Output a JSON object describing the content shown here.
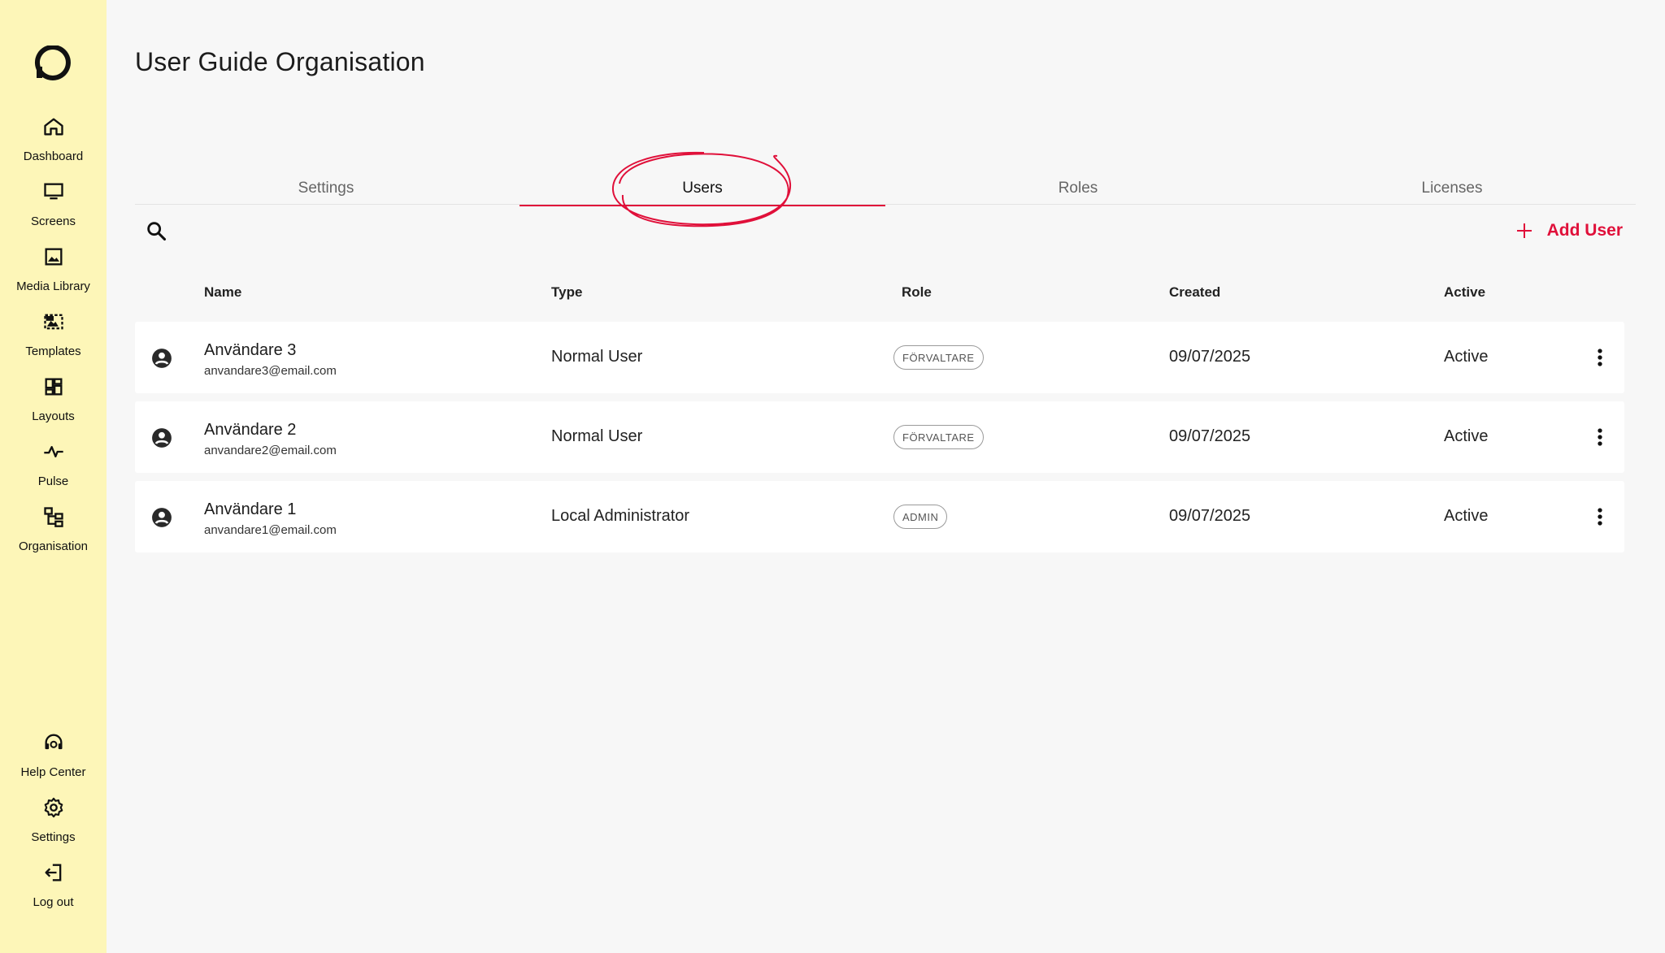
{
  "sidebar": {
    "logo": "logo-icon",
    "items": [
      {
        "label": "Dashboard",
        "icon": "home-icon"
      },
      {
        "label": "Screens",
        "icon": "monitor-icon"
      },
      {
        "label": "Media Library",
        "icon": "image-icon"
      },
      {
        "label": "Templates",
        "icon": "template-icon"
      },
      {
        "label": "Layouts",
        "icon": "layout-icon"
      },
      {
        "label": "Pulse",
        "icon": "pulse-icon"
      },
      {
        "label": "Organisation",
        "icon": "org-icon"
      }
    ],
    "bottom_items": [
      {
        "label": "Help Center",
        "icon": "headset-icon"
      },
      {
        "label": "Settings",
        "icon": "gear-icon"
      },
      {
        "label": "Log out",
        "icon": "logout-icon"
      }
    ]
  },
  "page": {
    "title": "User Guide Organisation"
  },
  "tabs": [
    {
      "label": "Settings",
      "active": false
    },
    {
      "label": "Users",
      "active": true
    },
    {
      "label": "Roles",
      "active": false
    },
    {
      "label": "Licenses",
      "active": false
    }
  ],
  "toolbar": {
    "add_user_label": "Add User"
  },
  "table": {
    "headers": {
      "name": "Name",
      "type": "Type",
      "role": "Role",
      "created": "Created",
      "active": "Active"
    },
    "rows": [
      {
        "name": "Användare 3",
        "email": "anvandare3@email.com",
        "type": "Normal User",
        "role": "FÖRVALTARE",
        "created": "09/07/2025",
        "active": "Active"
      },
      {
        "name": "Användare 2",
        "email": "anvandare2@email.com",
        "type": "Normal User",
        "role": "FÖRVALTARE",
        "created": "09/07/2025",
        "active": "Active"
      },
      {
        "name": "Användare 1",
        "email": "anvandare1@email.com",
        "type": "Local Administrator",
        "role": "ADMIN",
        "created": "09/07/2025",
        "active": "Active"
      }
    ]
  },
  "colors": {
    "accent": "#e0103a",
    "sidebar_bg": "#fdf6b8",
    "page_bg": "#f7f7f7"
  }
}
